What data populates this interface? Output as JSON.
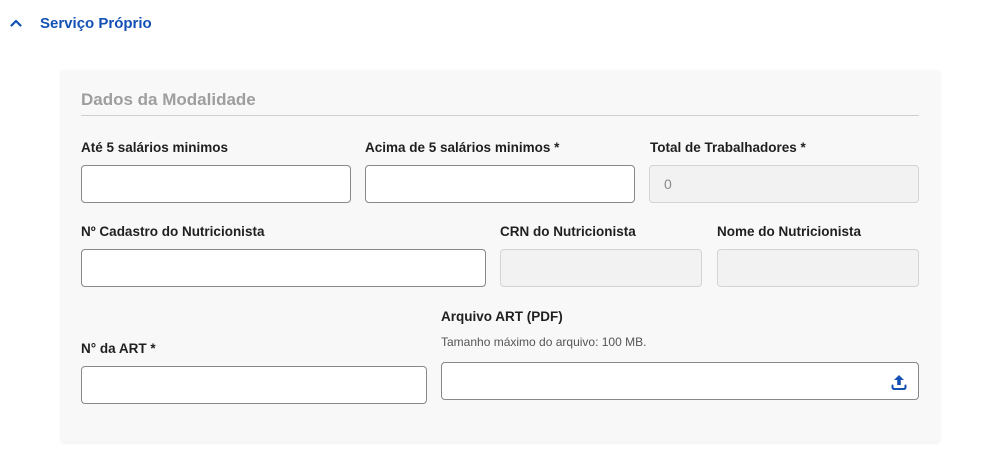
{
  "section": {
    "title": "Serviço Próprio",
    "toggle_icon": "chevron-up-icon",
    "accent_color": "#1351b4"
  },
  "card": {
    "title": "Dados da Modalidade"
  },
  "fields": {
    "ate5": {
      "label": "Até 5 salários minimos",
      "value": ""
    },
    "acima5": {
      "label": "Acima de 5 salários minimos *",
      "value": ""
    },
    "total": {
      "label": "Total de Trabalhadores *",
      "value": "0"
    },
    "cadastro": {
      "label": "Nº Cadastro do Nutricionista",
      "value": ""
    },
    "crn": {
      "label": "CRN do Nutricionista",
      "value": ""
    },
    "nome": {
      "label": "Nome do Nutricionista",
      "value": ""
    },
    "art": {
      "label": "N° da ART *",
      "value": ""
    },
    "arquivo": {
      "label": "Arquivo ART (PDF)",
      "hint": "Tamanho máximo do arquivo: 100 MB.",
      "upload_icon": "upload-icon"
    }
  }
}
